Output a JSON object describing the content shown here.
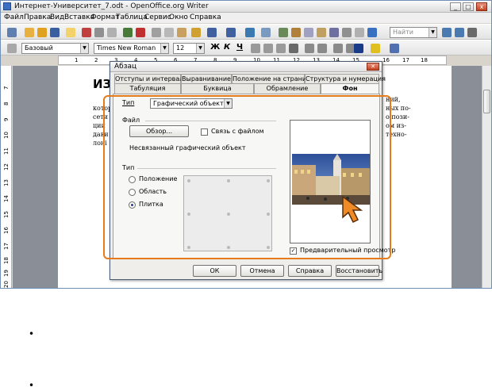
{
  "window": {
    "title": "Интернет-Университет_7.odt - OpenOffice.org Writer",
    "min_glyph": "_",
    "max_glyph": "□",
    "close_glyph": "x"
  },
  "menu": [
    "Файл",
    "Правка",
    "Вид",
    "Вставка",
    "Формат",
    "Таблица",
    "Сервис",
    "Окно",
    "Справка"
  ],
  "toolbar": {
    "find_placeholder": "Найти",
    "style": "Базовый",
    "font": "Times New Roman",
    "size": "12",
    "bold": "Ж",
    "italic": "К",
    "underline": "Ч"
  },
  "ruler": {
    "h_marks": [
      "1",
      "2",
      "3",
      "4",
      "5",
      "6",
      "7",
      "8",
      "9",
      "10",
      "11",
      "12",
      "13",
      "14",
      "15",
      "16",
      "17",
      "18"
    ],
    "v_marks": [
      "7",
      "8",
      "9",
      "10",
      "11",
      "12",
      "13",
      "14",
      "15",
      "16",
      "17",
      "18",
      "19",
      "20"
    ]
  },
  "document": {
    "heading": "ИЗ",
    "left_fragments": [
      "котор",
      "сети",
      "ции",
      "дави",
      "лоні"
    ],
    "right_fragments": [
      "ний,",
      "ных по-",
      "о пози-",
      "ом из-",
      "техно-"
    ]
  },
  "dialog": {
    "title": "Абзац",
    "tabs_row1": [
      "Отступы и интервалы",
      "Выравнивание",
      "Положение на странице",
      "Структура и нумерация"
    ],
    "tabs_row2": [
      "Табуляция",
      "Буквица",
      "Обрамление",
      "Фон"
    ],
    "type_label": "Тип",
    "type_value": "Графический объект",
    "file_section": "Файл",
    "browse_button": "Обзор...",
    "link_checkbox": "Связь с файлом",
    "link_checked": false,
    "unlinked_text": "Несвязанный графический объект",
    "type_section": "Тип",
    "radio_options": [
      "Положение",
      "Область",
      "Плитка"
    ],
    "selected_radio": "Плитка",
    "preview_checkbox": "Предварительный просмотр",
    "preview_checked": true,
    "buttons": [
      "ОК",
      "Отмена",
      "Справка",
      "Восстановить"
    ]
  },
  "colors": {
    "highlight": "#e57b1a",
    "title_close": "#c5421f"
  }
}
